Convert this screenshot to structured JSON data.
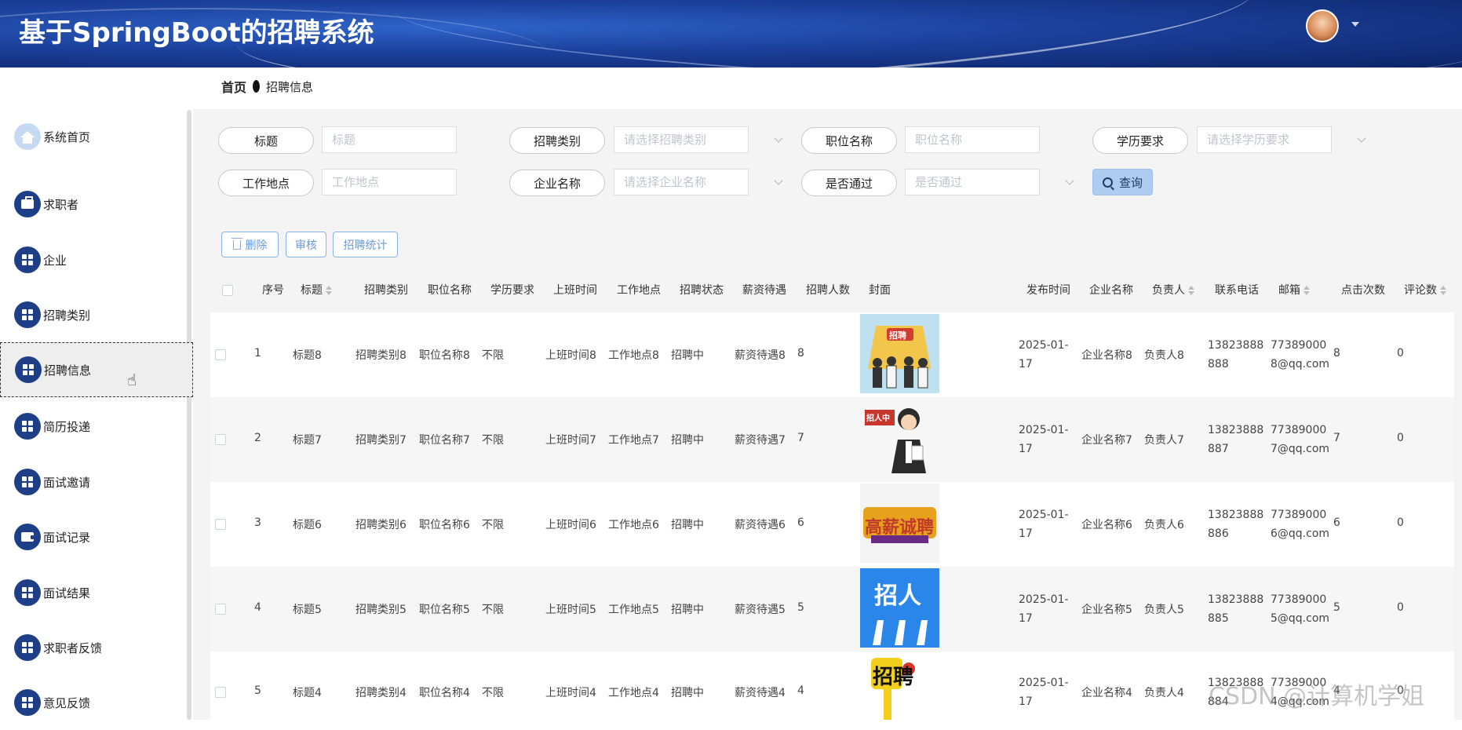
{
  "app": {
    "title": "基于SpringBoot的招聘系统"
  },
  "breadcrumb": {
    "home": "首页",
    "current": "招聘信息"
  },
  "sidebar": {
    "items": [
      {
        "label": "系统首页",
        "icon": "home-icon"
      },
      {
        "label": "求职者",
        "icon": "briefcase-icon"
      },
      {
        "label": "企业",
        "icon": "grid-icon"
      },
      {
        "label": "招聘类别",
        "icon": "grid-icon"
      },
      {
        "label": "招聘信息",
        "icon": "grid-icon"
      },
      {
        "label": "简历投递",
        "icon": "grid-icon"
      },
      {
        "label": "面试邀请",
        "icon": "grid-icon"
      },
      {
        "label": "面试记录",
        "icon": "wallet-icon"
      },
      {
        "label": "面试结果",
        "icon": "grid-icon"
      },
      {
        "label": "求职者反馈",
        "icon": "grid-icon"
      },
      {
        "label": "意见反馈",
        "icon": "grid-icon"
      }
    ],
    "active_label": "招聘信息"
  },
  "filters": {
    "title": {
      "label": "标题",
      "placeholder": "标题"
    },
    "category": {
      "label": "招聘类别",
      "placeholder": "请选择招聘类别"
    },
    "position": {
      "label": "职位名称",
      "placeholder": "职位名称"
    },
    "education": {
      "label": "学历要求",
      "placeholder": "请选择学历要求"
    },
    "location": {
      "label": "工作地点",
      "placeholder": "工作地点"
    },
    "company": {
      "label": "企业名称",
      "placeholder": "请选择企业名称"
    },
    "approved": {
      "label": "是否通过",
      "placeholder": "是否通过"
    },
    "search_button": "查询"
  },
  "actions": {
    "delete": "删除",
    "audit": "审核",
    "stats": "招聘统计"
  },
  "table": {
    "headers": {
      "index": "序号",
      "title": "标题",
      "category": "招聘类别",
      "position": "职位名称",
      "education": "学历要求",
      "work_time": "上班时间",
      "location": "工作地点",
      "status": "招聘状态",
      "salary": "薪资待遇",
      "headcount": "招聘人数",
      "cover": "封面",
      "publish_time": "发布时间",
      "company": "企业名称",
      "contact": "负责人",
      "phone": "联系电话",
      "email": "邮箱",
      "clicks": "点击次数",
      "comments": "评论数"
    },
    "rows": [
      {
        "index": "1",
        "title": "标题8",
        "category": "招聘类别8",
        "position": "职位名称8",
        "education": "不限",
        "work_time": "上班时间8",
        "location": "工作地点8",
        "status": "招聘中",
        "salary": "薪资待遇8",
        "headcount": "8",
        "cover_text": "招聘",
        "publish_time": "2025-01-17",
        "company": "企业名称8",
        "contact": "负责人8",
        "phone": "13823888888",
        "email": "773890008@qq.com",
        "clicks": "8",
        "comments": "0"
      },
      {
        "index": "2",
        "title": "标题7",
        "category": "招聘类别7",
        "position": "职位名称7",
        "education": "不限",
        "work_time": "上班时间7",
        "location": "工作地点7",
        "status": "招聘中",
        "salary": "薪资待遇7",
        "headcount": "7",
        "cover_text": "招人中",
        "publish_time": "2025-01-17",
        "company": "企业名称7",
        "contact": "负责人7",
        "phone": "13823888887",
        "email": "773890007@qq.com",
        "clicks": "7",
        "comments": "0"
      },
      {
        "index": "3",
        "title": "标题6",
        "category": "招聘类别6",
        "position": "职位名称6",
        "education": "不限",
        "work_time": "上班时间6",
        "location": "工作地点6",
        "status": "招聘中",
        "salary": "薪资待遇6",
        "headcount": "6",
        "cover_text": "高薪诚聘",
        "publish_time": "2025-01-17",
        "company": "企业名称6",
        "contact": "负责人6",
        "phone": "13823888886",
        "email": "773890006@qq.com",
        "clicks": "6",
        "comments": "0"
      },
      {
        "index": "4",
        "title": "标题5",
        "category": "招聘类别5",
        "position": "职位名称5",
        "education": "不限",
        "work_time": "上班时间5",
        "location": "工作地点5",
        "status": "招聘中",
        "salary": "薪资待遇5",
        "headcount": "5",
        "cover_text": "招人",
        "publish_time": "2025-01-17",
        "company": "企业名称5",
        "contact": "负责人5",
        "phone": "13823888885",
        "email": "773890005@qq.com",
        "clicks": "5",
        "comments": "0"
      },
      {
        "index": "5",
        "title": "标题4",
        "category": "招聘类别4",
        "position": "职位名称4",
        "education": "不限",
        "work_time": "上班时间4",
        "location": "工作地点4",
        "status": "招聘中",
        "salary": "薪资待遇4",
        "headcount": "4",
        "cover_text": "招聘",
        "publish_time": "2025-01-17",
        "company": "企业名称4",
        "contact": "负责人4",
        "phone": "13823888884",
        "email": "773890004@qq.com",
        "clicks": "4",
        "comments": "0"
      }
    ]
  },
  "watermark": "CSDN @计算机学姐",
  "colors": {
    "header": "#1b3f9a",
    "menu_icon": "#1e3f87",
    "search_button": "#aecbf0",
    "action_border": "#89b3e0"
  }
}
